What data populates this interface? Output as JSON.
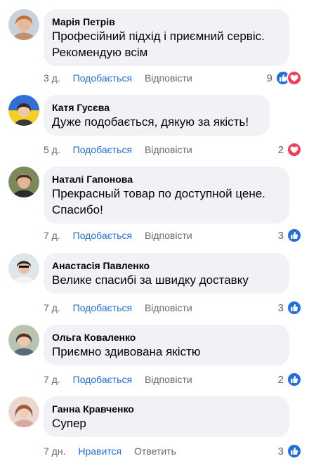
{
  "comments": [
    {
      "author": "Марія Петрів",
      "text": "Професійний підхід і приємний сервіс.\nРекомендую всім",
      "time": "3 д.",
      "like_label": "Подобається",
      "reply_label": "Відповісти",
      "reaction_count": "9",
      "reactions": [
        "like-icon",
        "heart-icon"
      ]
    },
    {
      "author": "Катя Гусєва",
      "text": "Дуже подобається, дякую за якість!",
      "time": "5 д.",
      "like_label": "Подобається",
      "reply_label": "Відповісти",
      "reaction_count": "2",
      "reactions": [
        "heart-icon"
      ]
    },
    {
      "author": "Наталі Гапонова",
      "text": "Прекрасный товар по доступной цене.\nСпасибо!",
      "time": "7 д.",
      "like_label": "Подобається",
      "reply_label": "Відповісти",
      "reaction_count": "3",
      "reactions": [
        "like-icon"
      ]
    },
    {
      "author": "Анастасія Павленко",
      "text": "Велике спасибі за швидку доставку",
      "time": "7 д.",
      "like_label": "Подобається",
      "reply_label": "Відповісти",
      "reaction_count": "3",
      "reactions": [
        "like-icon"
      ]
    },
    {
      "author": "Ольга Коваленко",
      "text": "Приємно здивована якістю",
      "time": "7 д.",
      "like_label": "Подобається",
      "reply_label": "Відповісти",
      "reaction_count": "2",
      "reactions": [
        "like-icon"
      ]
    },
    {
      "author": "Ганна Кравченко",
      "text": "Супер",
      "time": "7 дн.",
      "like_label": "Нравится",
      "reply_label": "Ответить",
      "reaction_count": "3",
      "reactions": [
        "like-icon"
      ]
    }
  ],
  "colors": {
    "like_blue": "#216fdb",
    "heart_red": "#f33e58",
    "bubble_bg": "#f0f2f5",
    "meta_gray": "#65676b"
  }
}
